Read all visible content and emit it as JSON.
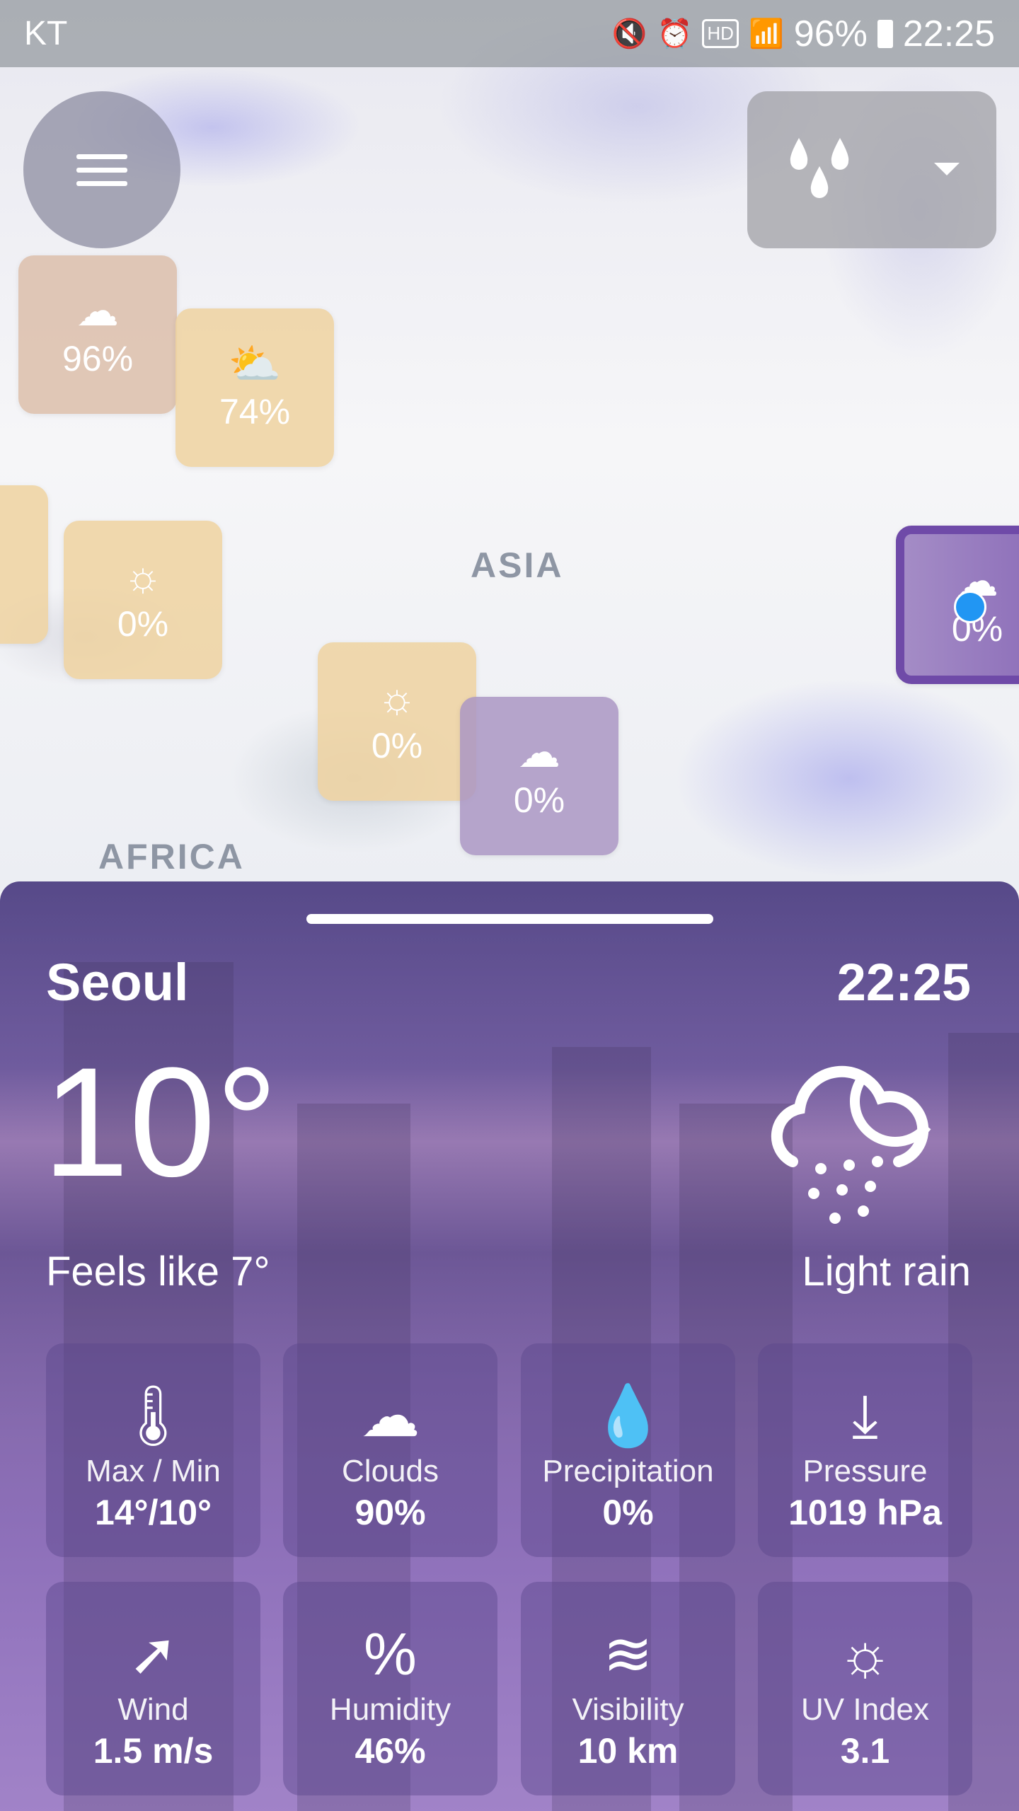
{
  "status_bar": {
    "carrier": "KT",
    "battery": "96%",
    "time": "22:25",
    "icons": [
      "mute-icon",
      "alarm-icon",
      "hd-voice-icon",
      "wifi-icon",
      "signal-icon",
      "battery-icon"
    ]
  },
  "map": {
    "labels": [
      "ASIA",
      "AFRICA"
    ],
    "markers": [
      {
        "icon": "cloud-icon",
        "glyph": "☁",
        "value": "96%"
      },
      {
        "icon": "sun-cloud-snow-icon",
        "glyph": "⛅",
        "value": "74%"
      },
      {
        "icon": "partial",
        "glyph": "",
        "value": ""
      },
      {
        "icon": "sun-icon",
        "glyph": "☼",
        "value": "0%"
      },
      {
        "icon": "sun-icon",
        "glyph": "☼",
        "value": "0%"
      },
      {
        "icon": "cloud-hail-icon",
        "glyph": "☁",
        "value": "0%"
      },
      {
        "icon": "cloud-moon-icon",
        "glyph": "☁",
        "value": "0%"
      }
    ]
  },
  "layer_selector": {
    "icon": "precipitation-drops-icon"
  },
  "current": {
    "city": "Seoul",
    "time": "22:25",
    "temp": "10°",
    "feels_like": "Feels like 7°",
    "condition": "Light rain",
    "condition_icon": "cloud-moon-rain-icon"
  },
  "tiles": [
    {
      "icon": "thermometer-icon",
      "glyph": "🌡",
      "label": "Max / Min",
      "value": "14°/10°"
    },
    {
      "icon": "cloud-icon",
      "glyph": "☁",
      "label": "Clouds",
      "value": "90%"
    },
    {
      "icon": "drops-icon",
      "glyph": "💧",
      "label": "Precipitation",
      "value": "0%"
    },
    {
      "icon": "pressure-download-icon",
      "glyph": "⤓",
      "label": "Pressure",
      "value": "1019 hPa"
    },
    {
      "icon": "wind-arrow-icon",
      "glyph": "➚",
      "label": "Wind",
      "value": "1.5 m/s"
    },
    {
      "icon": "humidity-icon",
      "glyph": "%",
      "label": "Humidity",
      "value": "46%"
    },
    {
      "icon": "fog-icon",
      "glyph": "≋",
      "label": "Visibility",
      "value": "10 km"
    },
    {
      "icon": "sun-icon",
      "glyph": "☼",
      "label": "UV Index",
      "value": "3.1"
    }
  ]
}
